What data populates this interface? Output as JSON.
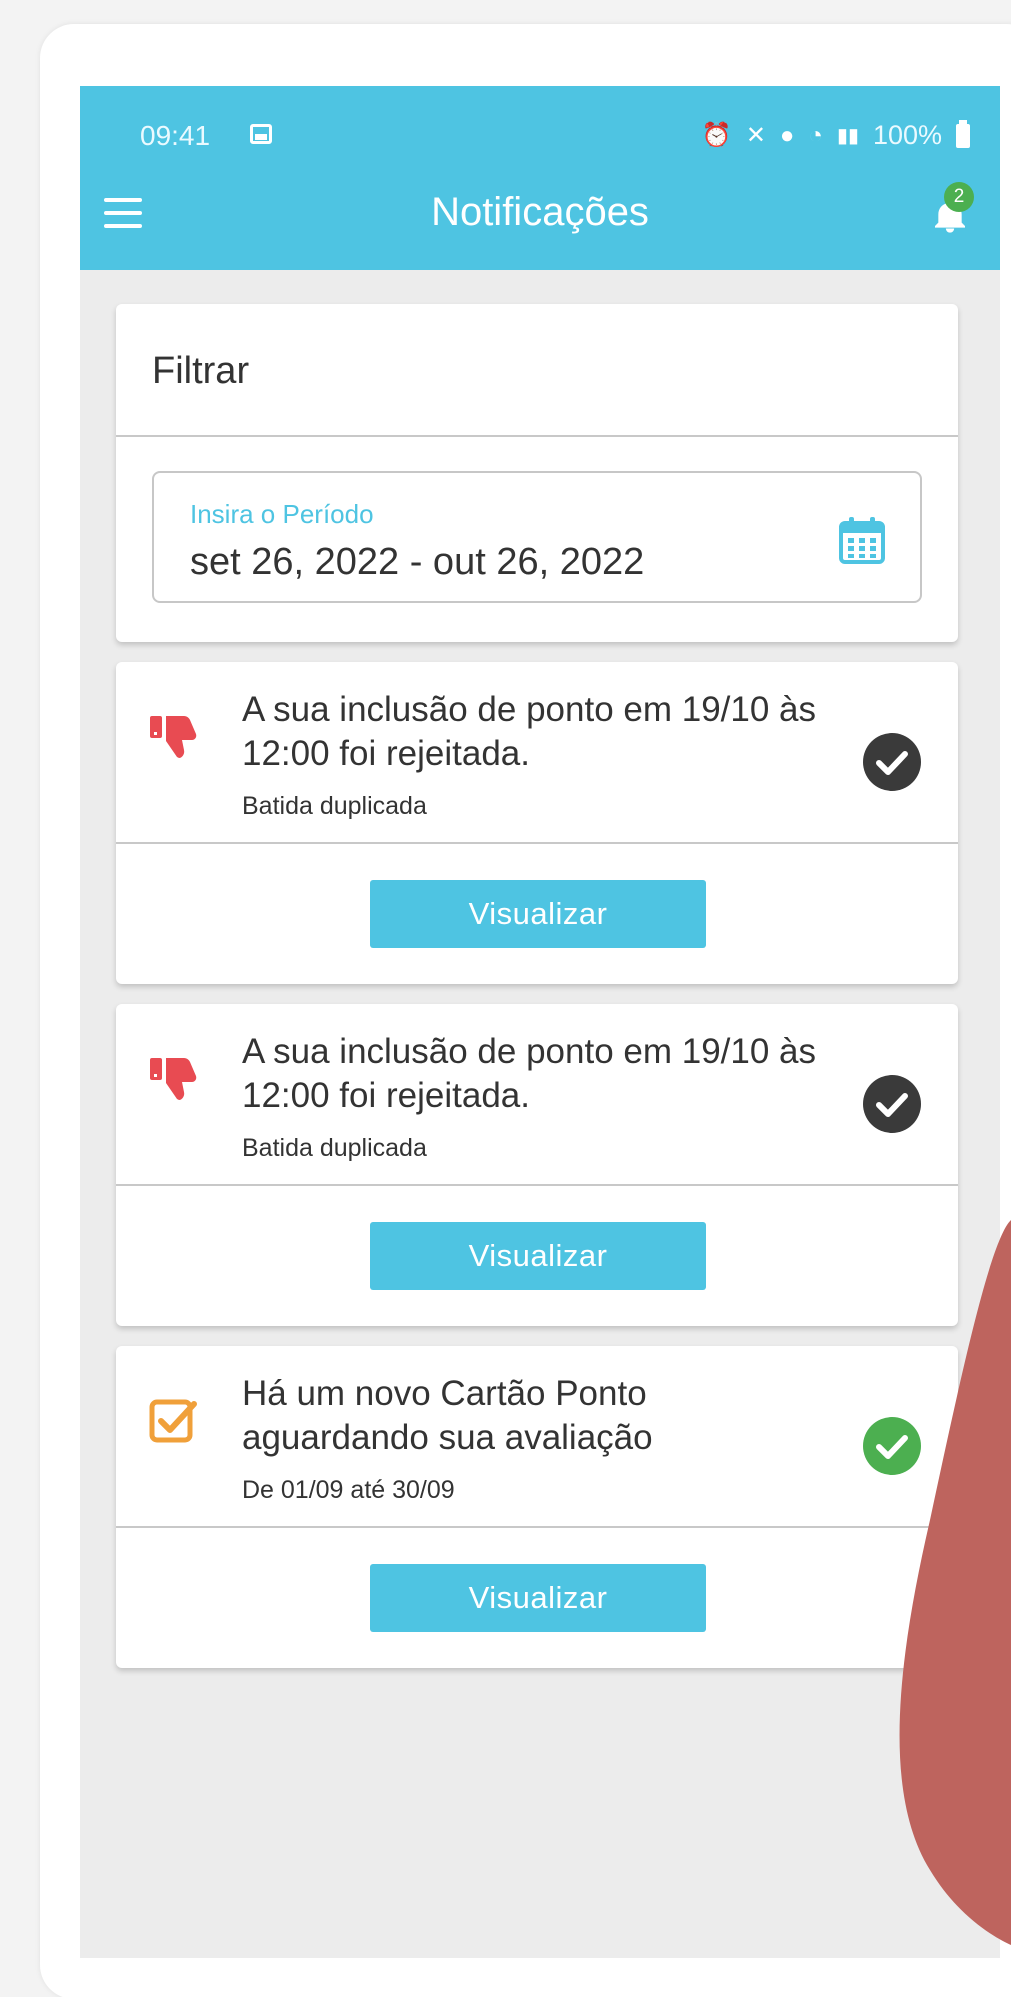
{
  "status_bar": {
    "time": "09:41",
    "battery": "100%",
    "icons": [
      "image-icon",
      "alarm-icon",
      "mute-icon",
      "location-icon",
      "wifi-icon",
      "volte-icon",
      "signal-icon",
      "battery-icon"
    ]
  },
  "header": {
    "title": "Notificações",
    "badge_count": "2"
  },
  "filter": {
    "title": "Filtrar",
    "period_label": "Insira o Período",
    "period_value": "set 26, 2022 - out 26, 2022"
  },
  "notifications": [
    {
      "icon": "thumbs-down-icon",
      "title": "A sua inclusão de ponto em 19/10 às 12:00 foi rejeitada.",
      "subtitle": "Batida duplicada",
      "status": "read",
      "button_label": "Visualizar"
    },
    {
      "icon": "thumbs-down-icon",
      "title": "A sua inclusão de ponto em 19/10 às 12:00 foi rejeitada.",
      "subtitle": "Batida duplicada",
      "status": "read",
      "button_label": "Visualizar"
    },
    {
      "icon": "checkbox-icon",
      "title": "Há um novo Cartão Ponto aguardando sua avaliação",
      "subtitle": "De 01/09 até 30/09",
      "status": "approved",
      "button_label": "Visualizar"
    }
  ],
  "colors": {
    "primary": "#4ec4e2",
    "reject": "#e84b52",
    "check_dark": "#3a3a3a",
    "check_green": "#4caf50",
    "pending_orange": "#f0a03a",
    "decor_blob": "#be645e"
  }
}
